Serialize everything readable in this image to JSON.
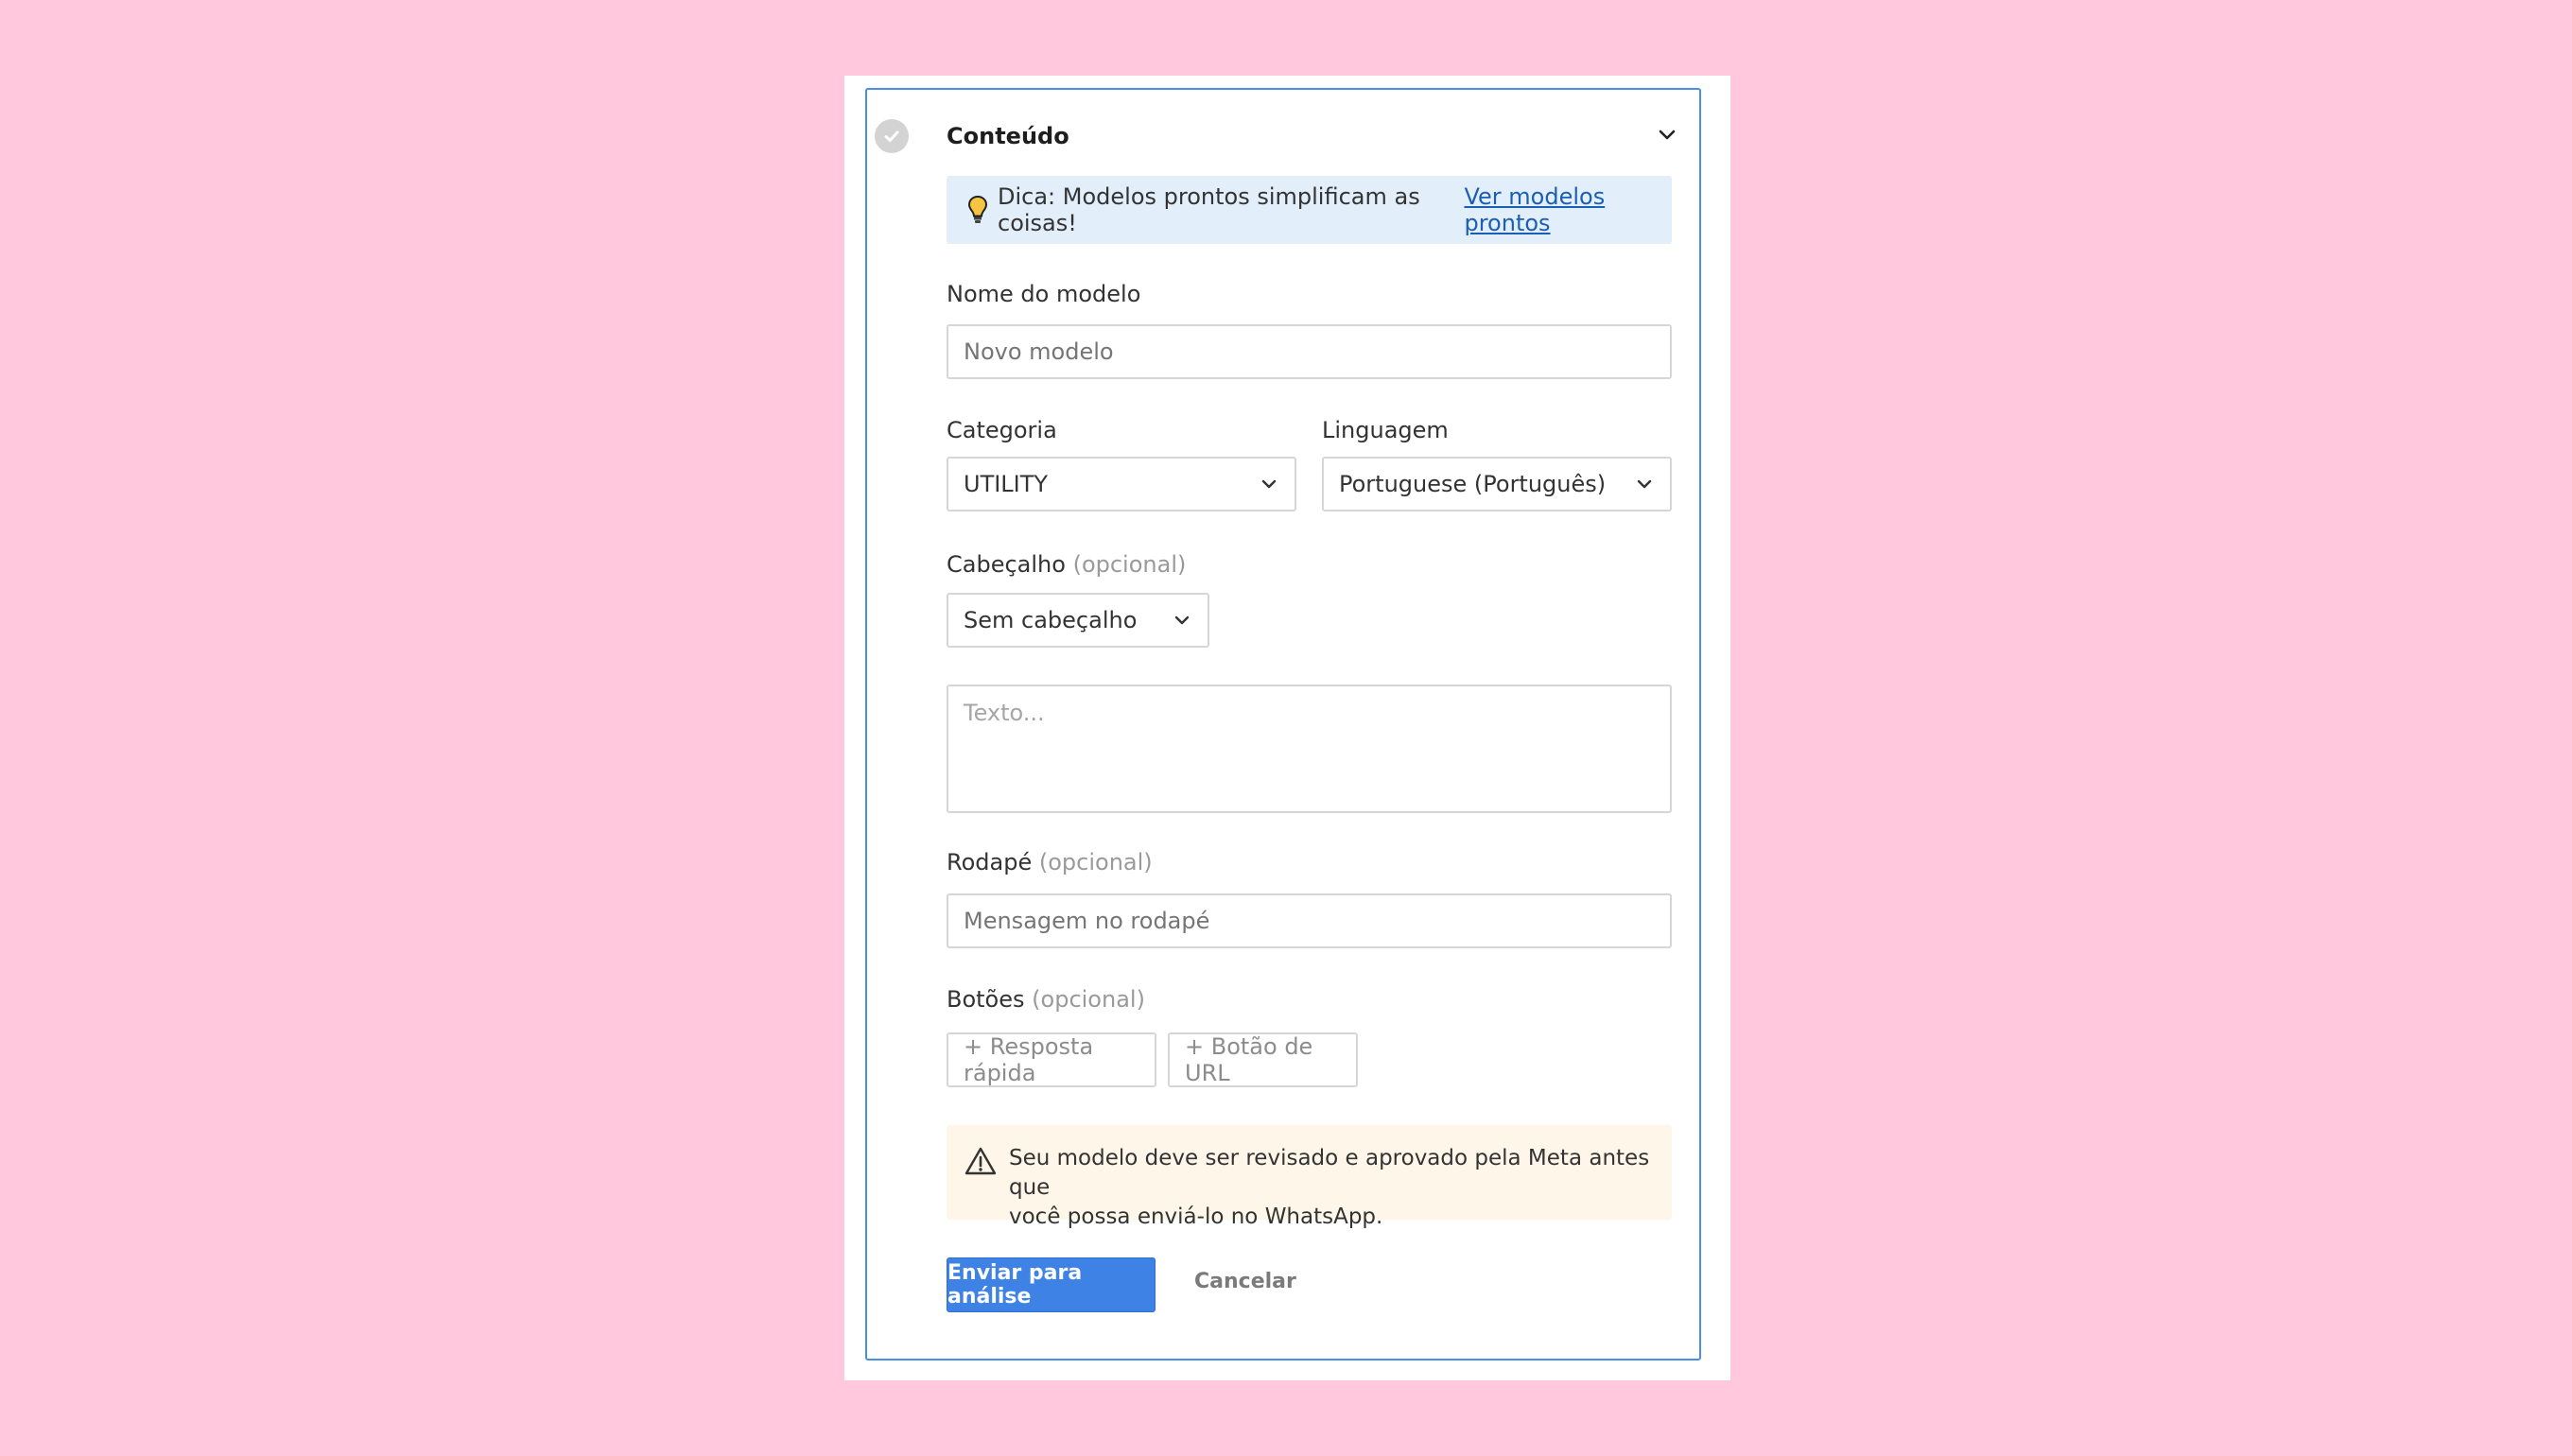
{
  "section": {
    "title": "Conteúdo",
    "icons": {
      "status": "check-icon",
      "collapse": "chevron-down-icon"
    }
  },
  "tip": {
    "text": "Dica: Modelos prontos simplificam as coisas!",
    "link": "Ver modelos prontos",
    "icon": "lightbulb-icon"
  },
  "name_field": {
    "label": "Nome do modelo",
    "placeholder": "Novo modelo",
    "value": ""
  },
  "category": {
    "label": "Categoria",
    "value": "UTILITY"
  },
  "language": {
    "label": "Linguagem",
    "value": "Portuguese (Português)"
  },
  "header": {
    "label": "Cabeçalho",
    "optional": "(opcional)",
    "value": "Sem cabeçalho"
  },
  "body_text": {
    "placeholder": "Texto..."
  },
  "footer": {
    "label": "Rodapé",
    "optional": "(opcional)",
    "placeholder": "Mensagem no rodapé"
  },
  "buttons": {
    "label": "Botões",
    "optional": "(opcional)",
    "quick_reply": "+ Resposta rápida",
    "url_button": "+ Botão de URL"
  },
  "warning": {
    "line1": "Seu modelo deve ser revisado e aprovado pela Meta antes que",
    "line2": "você possa enviá-lo no WhatsApp.",
    "icon": "warning-triangle-icon"
  },
  "actions": {
    "submit": "Enviar para análise",
    "cancel": "Cancelar"
  },
  "colors": {
    "background": "#ffc8dd",
    "accent": "#3f82e6",
    "panel_border": "#4a8fe3",
    "tip_bg": "#e3eefb",
    "warning_bg": "#fdf6e9"
  }
}
